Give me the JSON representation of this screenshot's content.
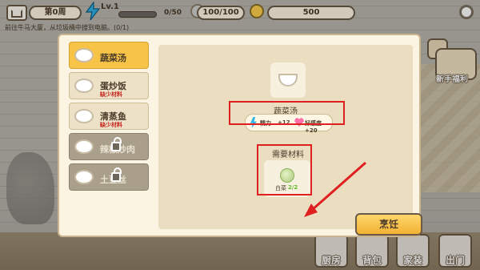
{
  "hud": {
    "day": "第0周",
    "level": "Lv.1",
    "xp_text": "0/50",
    "xp_progress": 0.0,
    "hearts": "100/100",
    "coins": "500",
    "task": "前往牛马大厦，从垃圾桶中搜到电脑。(0/1)"
  },
  "side": {
    "newbie": "新手福利"
  },
  "bottom_buttons": [
    "厨房",
    "背包",
    "家装",
    "出门"
  ],
  "recipes": [
    {
      "name": "蔬菜汤",
      "missing": "",
      "state": "active"
    },
    {
      "name": "蛋炒饭",
      "missing": "缺少材料",
      "state": "normal"
    },
    {
      "name": "清蒸鱼",
      "missing": "缺少材料",
      "state": "normal"
    },
    {
      "name": "辣椒炒肉",
      "missing": "",
      "state": "locked"
    },
    {
      "name": "土豆丝",
      "missing": "",
      "state": "locked"
    }
  ],
  "detail": {
    "dish_name": "蔬菜汤",
    "effects": {
      "energy_label": "精力",
      "energy_value": "+12",
      "favor_label": "好感度+20"
    },
    "requirements_title": "需要材料",
    "material_name": "白菜",
    "material_count": "2/2",
    "cook_label": "烹饪"
  },
  "colors": {
    "active_recipe": "#f7c447",
    "highlight": "#e02020",
    "missing": "#c6251e"
  }
}
